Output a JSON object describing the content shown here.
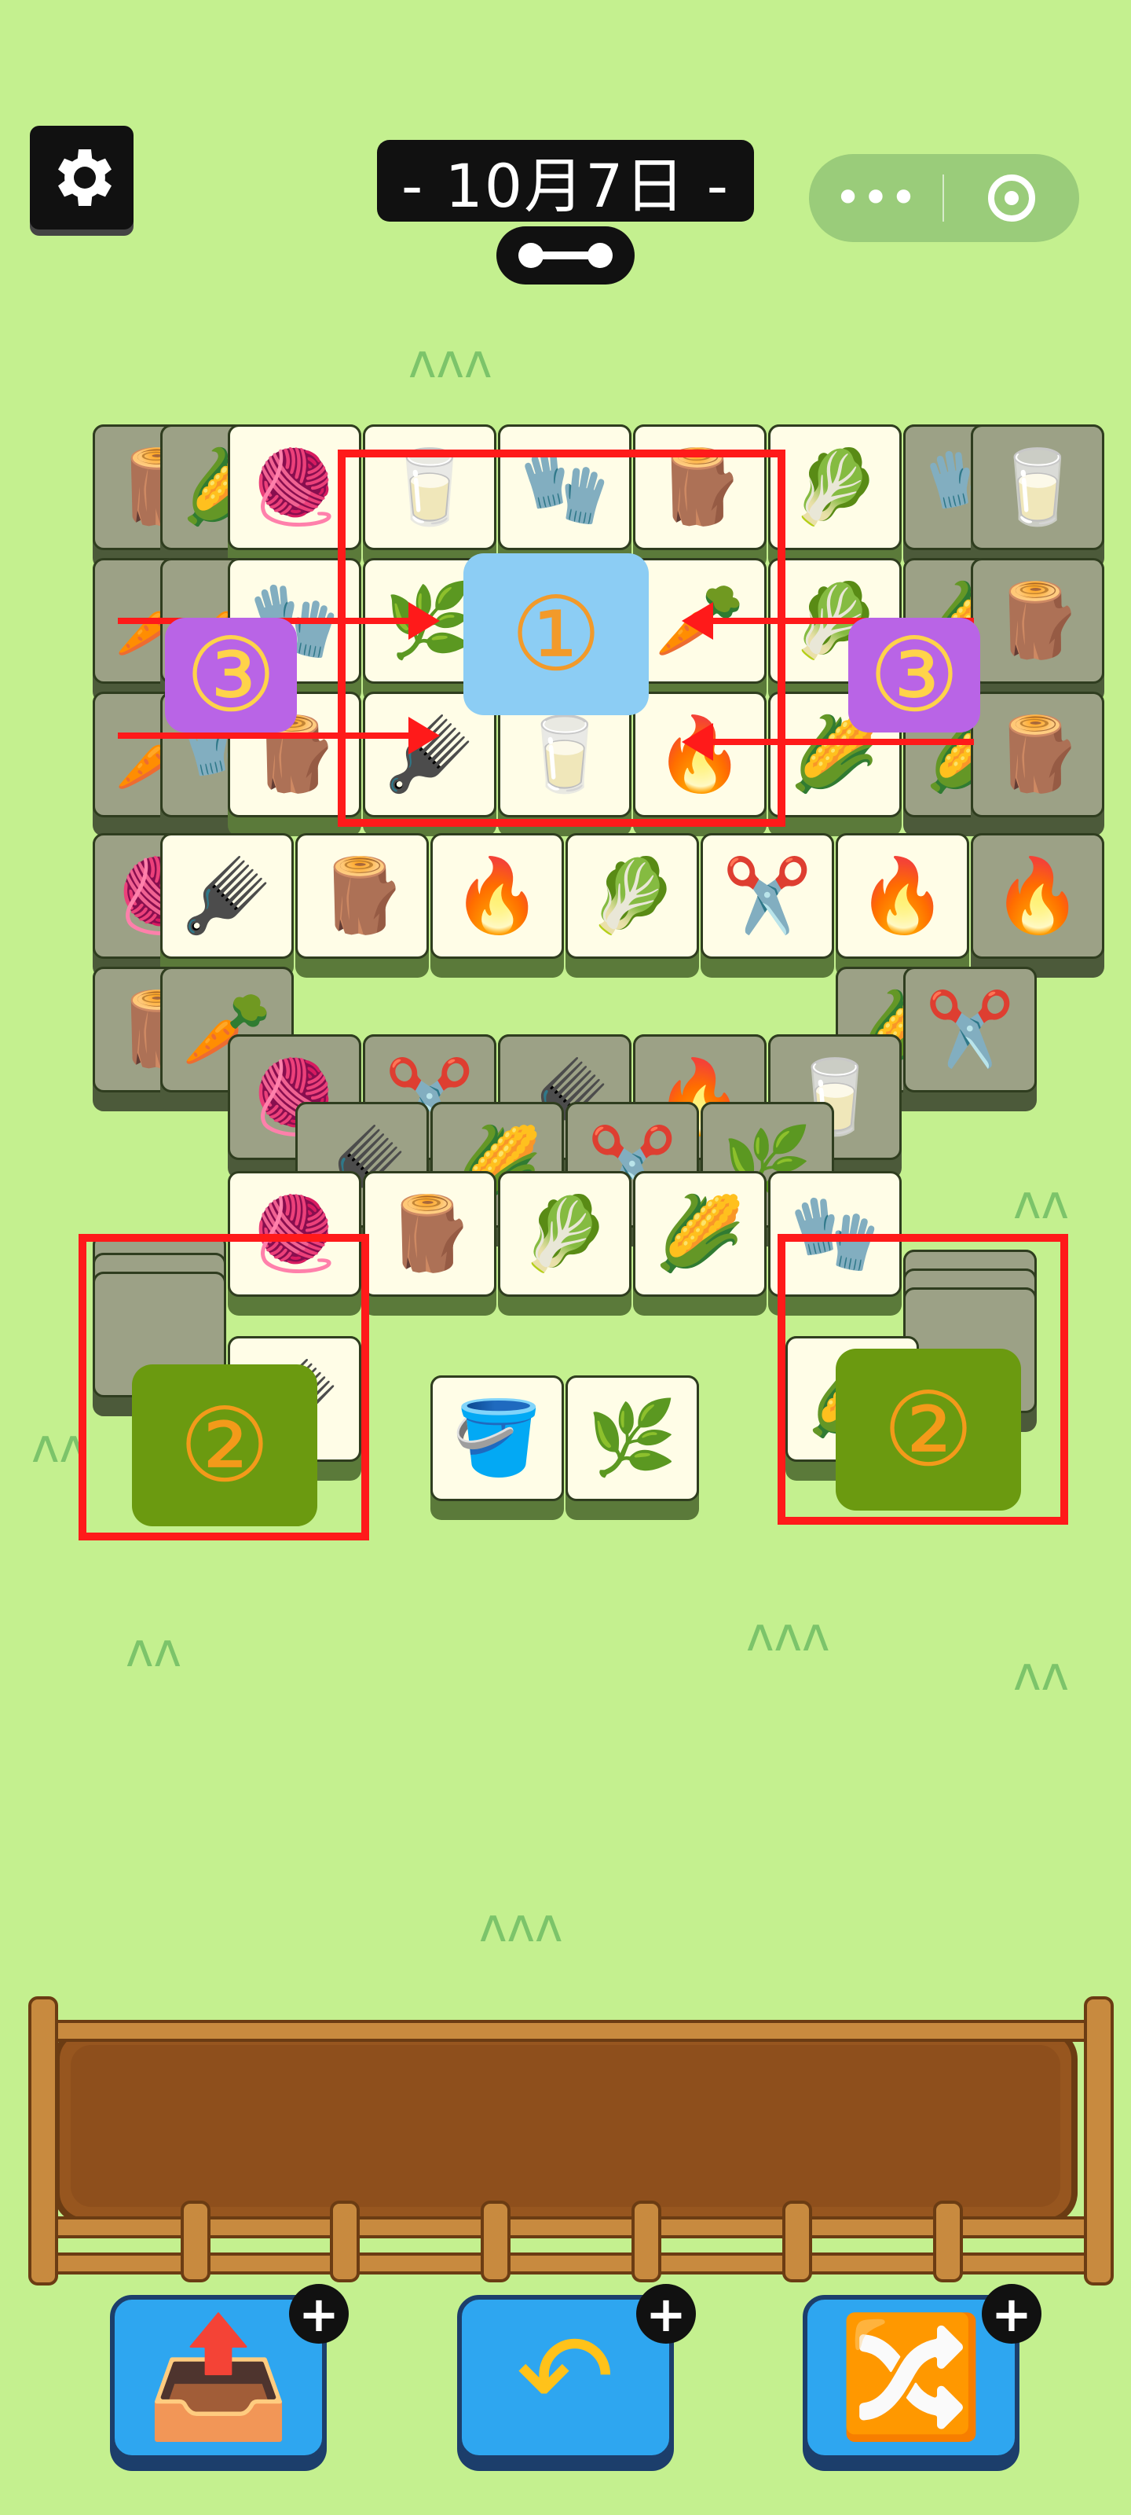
{
  "header": {
    "date_label": "- 10月7日 -",
    "settings_icon": "gear-icon",
    "progress_icon": "progress-bar-icon",
    "menu_icon": "more-dots-icon",
    "close_icon": "target-circle-icon"
  },
  "board": {
    "tiles": [
      {
        "icon": "🪵",
        "dim": true
      },
      {
        "icon": "🌽",
        "dim": true
      },
      {
        "icon": "🧶",
        "dim": false
      },
      {
        "icon": "🥛",
        "dim": false
      },
      {
        "icon": "🧤",
        "dim": false
      },
      {
        "icon": "🪵",
        "dim": false
      },
      {
        "icon": "🥬",
        "dim": false
      },
      {
        "icon": "🧤",
        "dim": true
      },
      {
        "icon": "🥛",
        "dim": true
      },
      {
        "icon": "🥕",
        "dim": true
      },
      {
        "icon": "🥕",
        "dim": true
      },
      {
        "icon": "🧤",
        "dim": false
      },
      {
        "icon": "🌿",
        "dim": false
      },
      {
        "icon": "🥛",
        "dim": false
      },
      {
        "icon": "🥕",
        "dim": false
      },
      {
        "icon": "🥬",
        "dim": false
      },
      {
        "icon": "🌽",
        "dim": true
      },
      {
        "icon": "🪵",
        "dim": true
      },
      {
        "icon": "🥕",
        "dim": true
      },
      {
        "icon": "🧤",
        "dim": true
      },
      {
        "icon": "🪵",
        "dim": false
      },
      {
        "icon": "🪮",
        "dim": false
      },
      {
        "icon": "🥛",
        "dim": false
      },
      {
        "icon": "🔥",
        "dim": false
      },
      {
        "icon": "🌽",
        "dim": false
      },
      {
        "icon": "🌽",
        "dim": true
      },
      {
        "icon": "🪵",
        "dim": true
      },
      {
        "icon": "🧶",
        "dim": true
      },
      {
        "icon": "🪮",
        "dim": false
      },
      {
        "icon": "🪵",
        "dim": false
      },
      {
        "icon": "🔥",
        "dim": false
      },
      {
        "icon": "🥬",
        "dim": false
      },
      {
        "icon": "✂️",
        "dim": false
      },
      {
        "icon": "🔥",
        "dim": false
      },
      {
        "icon": "🔥",
        "dim": true
      },
      {
        "icon": "🪵",
        "dim": true
      },
      {
        "icon": "🥕",
        "dim": true
      },
      {
        "icon": "🌽",
        "dim": true
      },
      {
        "icon": "✂️",
        "dim": true
      },
      {
        "icon": "🧶",
        "dim": true
      },
      {
        "icon": "✂️",
        "dim": true
      },
      {
        "icon": "🪮",
        "dim": true
      },
      {
        "icon": "🔥",
        "dim": true
      },
      {
        "icon": "🥛",
        "dim": true
      },
      {
        "icon": "🪮",
        "dim": true
      },
      {
        "icon": "🌽",
        "dim": true
      },
      {
        "icon": "✂️",
        "dim": true
      },
      {
        "icon": "🌿",
        "dim": true
      },
      {
        "icon": "🧶",
        "dim": false
      },
      {
        "icon": "🪵",
        "dim": false
      },
      {
        "icon": "🥬",
        "dim": false
      },
      {
        "icon": "🌽",
        "dim": false
      },
      {
        "icon": "🧤",
        "dim": false
      },
      {
        "icon": "🪣",
        "dim": false
      },
      {
        "icon": "🌿",
        "dim": false
      }
    ],
    "left_stack_top": "🪮",
    "right_stack_top": "🌽"
  },
  "annotations": {
    "badge_1": "①",
    "badge_2": "②",
    "badge_3": "③"
  },
  "tools": [
    {
      "icon": "📤",
      "name": "move-out-tool",
      "plus": "+"
    },
    {
      "icon": "↶",
      "name": "undo-tool",
      "plus": "+"
    },
    {
      "icon": "🔀",
      "name": "shuffle-tool",
      "plus": "+"
    }
  ],
  "colors": {
    "background": "#c4f08f",
    "highlight_red": "#ff1a1a",
    "tool_blue": "#2ea6f0"
  }
}
